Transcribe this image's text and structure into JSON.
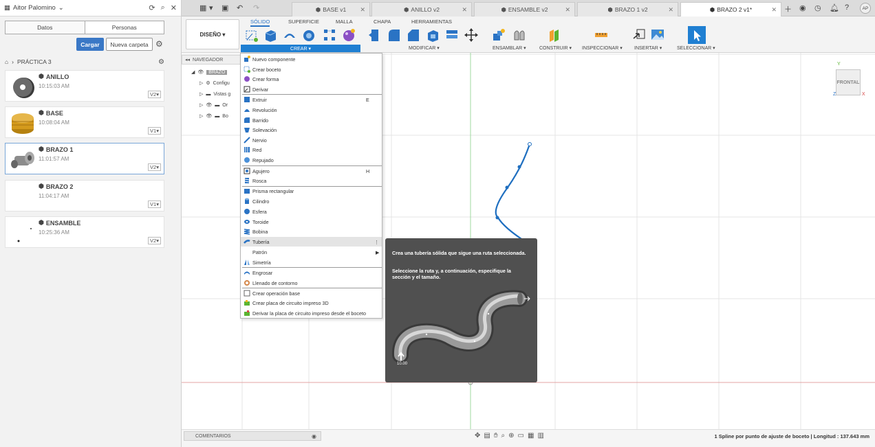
{
  "user": {
    "name": "Aitor Palomino",
    "initials": "AP"
  },
  "data_panel": {
    "tabs": [
      "Datos",
      "Personas"
    ],
    "upload_label": "Cargar",
    "new_folder_label": "Nueva carpeta",
    "breadcrumb": "PRÁCTICA 3",
    "files": [
      {
        "name": "ANILLO",
        "time": "10:15:03 AM",
        "version": "V2▾"
      },
      {
        "name": "BASE",
        "time": "10:08:04 AM",
        "version": "V1▾"
      },
      {
        "name": "BRAZO 1",
        "time": "11:01:57 AM",
        "version": "V2▾"
      },
      {
        "name": "BRAZO 2",
        "time": "11:04:17 AM",
        "version": "V1▾"
      },
      {
        "name": "ENSAMBLE",
        "time": "10:25:36 AM",
        "version": "V2▾"
      }
    ]
  },
  "doc_tabs": [
    "BASE v1",
    "ANILLO v2",
    "ENSAMBLE v2",
    "BRAZO 1 v2",
    "BRAZO 2 v1*"
  ],
  "workspace": {
    "label": "DISEÑO ▾"
  },
  "ribbon_tabs": [
    "SÓLIDO",
    "SUPERFICIE",
    "MALLA",
    "CHAPA",
    "HERRAMIENTAS"
  ],
  "ribbon_groups": [
    "CREAR ▾",
    "MODIFICAR ▾",
    "ENSAMBLAR ▾",
    "CONSTRUIR ▾",
    "INSPECCIONAR ▾",
    "INSERTAR ▾",
    "SELECCIONAR ▾"
  ],
  "navigator": {
    "title": "NAVEGADOR",
    "root": "BRAZO",
    "items": [
      "Configu",
      "Vistas g",
      "Or",
      "Bo"
    ]
  },
  "create_menu": {
    "items": [
      {
        "label": "Nuevo componente",
        "shortcut": ""
      },
      {
        "label": "Crear boceto",
        "shortcut": ""
      },
      {
        "label": "Crear forma",
        "shortcut": ""
      },
      {
        "label": "Derivar",
        "shortcut": ""
      },
      {
        "label": "Extruir",
        "shortcut": "E"
      },
      {
        "label": "Revolución",
        "shortcut": ""
      },
      {
        "label": "Barrido",
        "shortcut": ""
      },
      {
        "label": "Solevación",
        "shortcut": ""
      },
      {
        "label": "Nervio",
        "shortcut": ""
      },
      {
        "label": "Red",
        "shortcut": ""
      },
      {
        "label": "Repujado",
        "shortcut": ""
      },
      {
        "label": "Agujero",
        "shortcut": "H"
      },
      {
        "label": "Rosca",
        "shortcut": ""
      },
      {
        "label": "Prisma rectangular",
        "shortcut": ""
      },
      {
        "label": "Cilindro",
        "shortcut": ""
      },
      {
        "label": "Esfera",
        "shortcut": ""
      },
      {
        "label": "Toroide",
        "shortcut": ""
      },
      {
        "label": "Bobina",
        "shortcut": ""
      },
      {
        "label": "Tubería",
        "shortcut": "⋮"
      },
      {
        "label": "Patrón",
        "shortcut": "▶"
      },
      {
        "label": "Simetría",
        "shortcut": ""
      },
      {
        "label": "Engrosar",
        "shortcut": ""
      },
      {
        "label": "Llenado de contorno",
        "shortcut": ""
      },
      {
        "label": "Crear operación base",
        "shortcut": ""
      },
      {
        "label": "Crear placa de circuito impreso 3D",
        "shortcut": ""
      },
      {
        "label": "Derivar la placa de circuito impreso desde el boceto",
        "shortcut": ""
      }
    ]
  },
  "tooltip": {
    "line1": "Crea una tubería sólida que sigue una ruta seleccionada.",
    "line2": "Seleccione la ruta y, a continuación, especifique la sección y el tamaño.",
    "dim_label": "10.00"
  },
  "viewcube": {
    "face": "FRONTAL",
    "axis_y": "Y",
    "axis_z": "Z",
    "axis_x": "X"
  },
  "bottom": {
    "comments": "COMENTARIOS",
    "status": "1 Spline por punto de ajuste de boceto | Longitud : 137.643 mm"
  },
  "colors": {
    "accent": "#1f7fd2",
    "spline": "#1f6fc0",
    "tooltip_bg": "#505050"
  }
}
